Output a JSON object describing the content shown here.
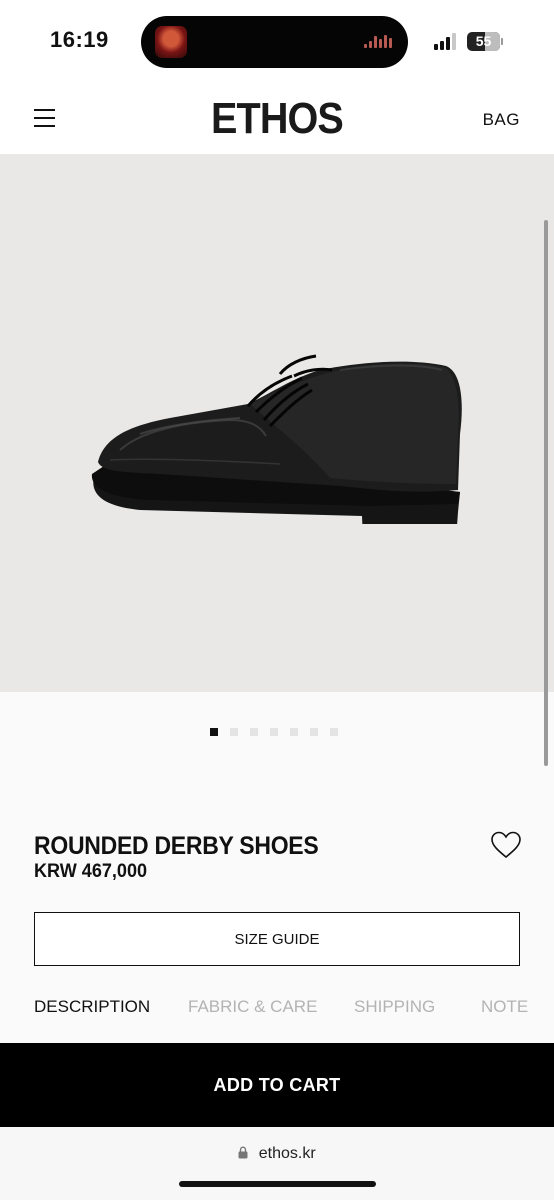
{
  "status_bar": {
    "time": "16:19",
    "battery_level": "55",
    "battery_percent": 55,
    "signal_bars_active": 3
  },
  "header": {
    "brand": "ETHOS",
    "bag_label": "BAG",
    "menu_icon": "hamburger-menu-icon"
  },
  "gallery": {
    "image_alt": "rounded-derby-shoe-black",
    "background": "#e9e8e6",
    "slide_count": 7,
    "active_slide": 1
  },
  "product": {
    "name": "ROUNDED DERBY SHOES",
    "price": "KRW 467,000",
    "wishlist_icon": "heart-icon"
  },
  "size_guide_label": "SIZE GUIDE",
  "tabs": [
    {
      "label": "DESCRIPTION",
      "active": true
    },
    {
      "label": "FABRIC & CARE",
      "active": false
    },
    {
      "label": "SHIPPING",
      "active": false
    },
    {
      "label": "NOTE",
      "active": false
    }
  ],
  "cart_button_label": "ADD TO CART",
  "browser": {
    "url": "ethos.kr",
    "lock_icon": "lock-icon"
  }
}
